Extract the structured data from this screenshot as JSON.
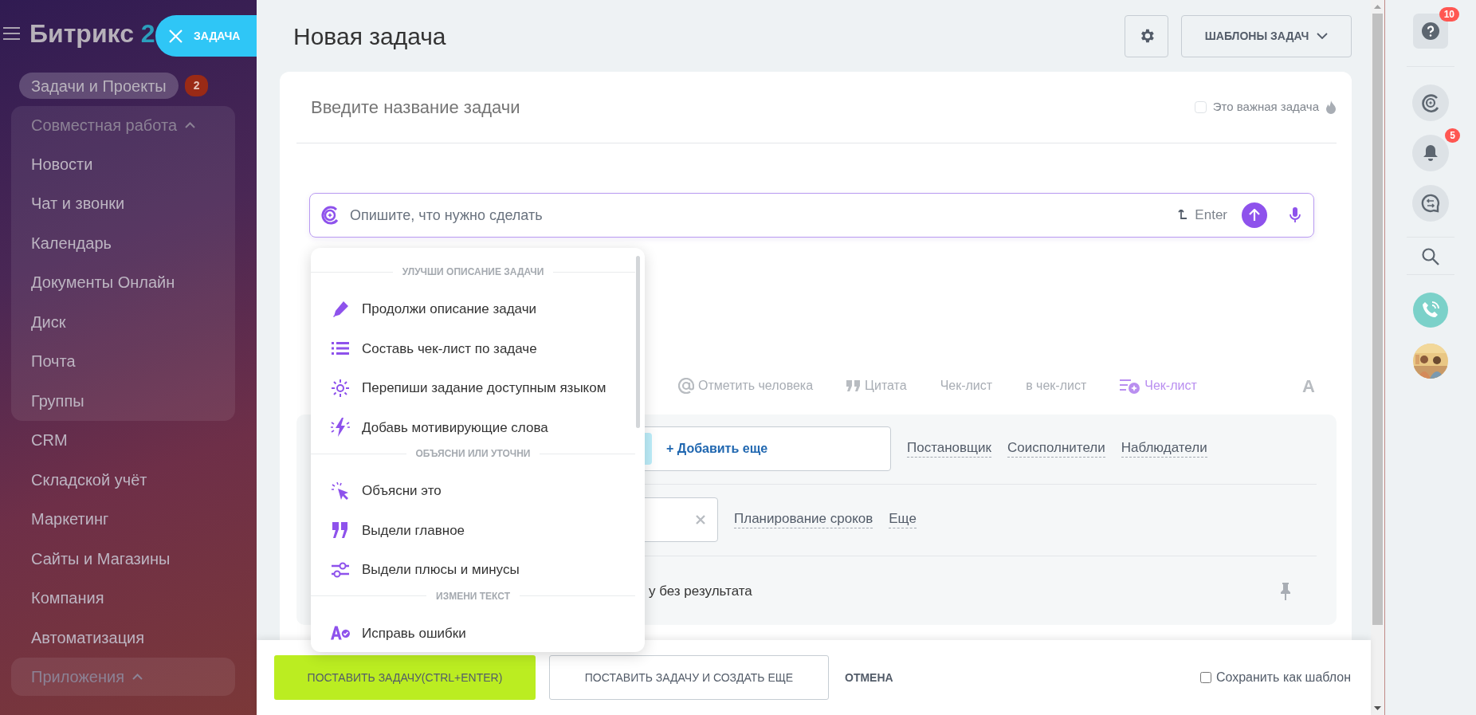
{
  "sidebar": {
    "logo": {
      "text": "Битрикс",
      "accent": "2"
    },
    "pinned": {
      "label": "Задачи и Проекты",
      "badge": "2",
      "selected": true
    },
    "menu": [
      {
        "kind": "group",
        "label": "Совместная работа",
        "expanded": true,
        "children": [
          {
            "label": "Новости"
          },
          {
            "label": "Чат и звонки"
          },
          {
            "label": "Календарь"
          },
          {
            "label": "Документы Онлайн"
          },
          {
            "label": "Диск"
          },
          {
            "label": "Почта"
          },
          {
            "label": "Группы"
          }
        ]
      },
      {
        "kind": "item",
        "label": "CRM"
      },
      {
        "kind": "item",
        "label": "Складской учёт"
      },
      {
        "kind": "item",
        "label": "Маркетинг"
      },
      {
        "kind": "item",
        "label": "Сайты и Магазины"
      },
      {
        "kind": "item",
        "label": "Компания"
      },
      {
        "kind": "item",
        "label": "Автоматизация"
      },
      {
        "kind": "group",
        "label": "Приложения",
        "expanded": true
      }
    ]
  },
  "close_chip": {
    "label": "ЗАДАЧА"
  },
  "header": {
    "title": "Новая задача",
    "templates_button": "ШАБЛОНЫ ЗАДАЧ"
  },
  "task": {
    "title_placeholder": "Введите название задачи",
    "important": {
      "label": "Это важная задача",
      "checked": false
    }
  },
  "ai_prompt": {
    "placeholder": "Опишите, что нужно сделать",
    "hint": "Enter"
  },
  "ai_menu": {
    "sections": [
      {
        "title": "УЛУЧШИ ОПИСАНИЕ ЗАДАЧИ",
        "items": [
          "Продолжи описание задачи",
          "Составь чек-лист по задаче",
          "Перепиши задание доступным языком",
          "Добавь мотивирующие слова"
        ]
      },
      {
        "title": "ОБЪЯСНИ ИЛИ УТОЧНИ",
        "items": [
          "Объясни это",
          "Выдели главное",
          "Выдели плюсы и минусы"
        ]
      },
      {
        "title": "ИЗМЕНИ ТЕКСТ",
        "items": [
          "Исправь ошибки"
        ]
      }
    ]
  },
  "toolbar": [
    {
      "kind": "mention",
      "label": "Отметить человека"
    },
    {
      "kind": "quote",
      "label": "Цитата"
    },
    {
      "kind": "plain",
      "label": "Чек-лист"
    },
    {
      "kind": "plain",
      "label": "в чек-лист"
    },
    {
      "kind": "copilot",
      "label": "Чек-лист"
    },
    {
      "kind": "format",
      "label": "A"
    }
  ],
  "people": {
    "add_button": "+ Добавить еще",
    "links": [
      "Постановщик",
      "Соисполнители",
      "Наблюдатели"
    ]
  },
  "deadline": {
    "links": [
      "Планирование сроков",
      "Еще"
    ]
  },
  "result": {
    "text": "у без результата"
  },
  "footer": {
    "buttons": [
      {
        "kind": "primary",
        "label": "ПОСТАВИТЬ ЗАДАЧУ(CTRL+ENTER)"
      },
      {
        "kind": "outline",
        "label": "ПОСТАВИТЬ ЗАДАЧУ И СОЗДАТЬ ЕЩЕ"
      },
      {
        "kind": "link",
        "label": "ОТМЕНА"
      }
    ],
    "save_template": {
      "label": "Сохранить как шаблон",
      "checked": false
    }
  },
  "right_panel": {
    "help_badge": "10",
    "notifications_badge": "5"
  }
}
